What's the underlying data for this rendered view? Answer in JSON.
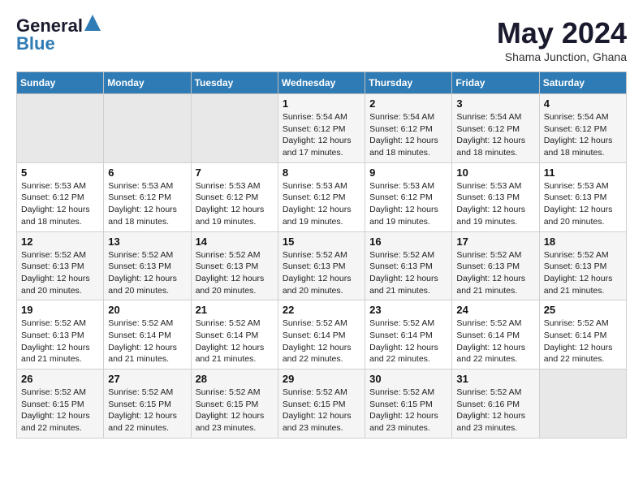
{
  "logo": {
    "line1": "General",
    "line2": "Blue"
  },
  "title": "May 2024",
  "subtitle": "Shama Junction, Ghana",
  "days_of_week": [
    "Sunday",
    "Monday",
    "Tuesday",
    "Wednesday",
    "Thursday",
    "Friday",
    "Saturday"
  ],
  "weeks": [
    [
      {
        "day": "",
        "info": ""
      },
      {
        "day": "",
        "info": ""
      },
      {
        "day": "",
        "info": ""
      },
      {
        "day": "1",
        "info": "Sunrise: 5:54 AM\nSunset: 6:12 PM\nDaylight: 12 hours\nand 17 minutes."
      },
      {
        "day": "2",
        "info": "Sunrise: 5:54 AM\nSunset: 6:12 PM\nDaylight: 12 hours\nand 18 minutes."
      },
      {
        "day": "3",
        "info": "Sunrise: 5:54 AM\nSunset: 6:12 PM\nDaylight: 12 hours\nand 18 minutes."
      },
      {
        "day": "4",
        "info": "Sunrise: 5:54 AM\nSunset: 6:12 PM\nDaylight: 12 hours\nand 18 minutes."
      }
    ],
    [
      {
        "day": "5",
        "info": "Sunrise: 5:53 AM\nSunset: 6:12 PM\nDaylight: 12 hours\nand 18 minutes."
      },
      {
        "day": "6",
        "info": "Sunrise: 5:53 AM\nSunset: 6:12 PM\nDaylight: 12 hours\nand 18 minutes."
      },
      {
        "day": "7",
        "info": "Sunrise: 5:53 AM\nSunset: 6:12 PM\nDaylight: 12 hours\nand 19 minutes."
      },
      {
        "day": "8",
        "info": "Sunrise: 5:53 AM\nSunset: 6:12 PM\nDaylight: 12 hours\nand 19 minutes."
      },
      {
        "day": "9",
        "info": "Sunrise: 5:53 AM\nSunset: 6:12 PM\nDaylight: 12 hours\nand 19 minutes."
      },
      {
        "day": "10",
        "info": "Sunrise: 5:53 AM\nSunset: 6:13 PM\nDaylight: 12 hours\nand 19 minutes."
      },
      {
        "day": "11",
        "info": "Sunrise: 5:53 AM\nSunset: 6:13 PM\nDaylight: 12 hours\nand 20 minutes."
      }
    ],
    [
      {
        "day": "12",
        "info": "Sunrise: 5:52 AM\nSunset: 6:13 PM\nDaylight: 12 hours\nand 20 minutes."
      },
      {
        "day": "13",
        "info": "Sunrise: 5:52 AM\nSunset: 6:13 PM\nDaylight: 12 hours\nand 20 minutes."
      },
      {
        "day": "14",
        "info": "Sunrise: 5:52 AM\nSunset: 6:13 PM\nDaylight: 12 hours\nand 20 minutes."
      },
      {
        "day": "15",
        "info": "Sunrise: 5:52 AM\nSunset: 6:13 PM\nDaylight: 12 hours\nand 20 minutes."
      },
      {
        "day": "16",
        "info": "Sunrise: 5:52 AM\nSunset: 6:13 PM\nDaylight: 12 hours\nand 21 minutes."
      },
      {
        "day": "17",
        "info": "Sunrise: 5:52 AM\nSunset: 6:13 PM\nDaylight: 12 hours\nand 21 minutes."
      },
      {
        "day": "18",
        "info": "Sunrise: 5:52 AM\nSunset: 6:13 PM\nDaylight: 12 hours\nand 21 minutes."
      }
    ],
    [
      {
        "day": "19",
        "info": "Sunrise: 5:52 AM\nSunset: 6:13 PM\nDaylight: 12 hours\nand 21 minutes."
      },
      {
        "day": "20",
        "info": "Sunrise: 5:52 AM\nSunset: 6:14 PM\nDaylight: 12 hours\nand 21 minutes."
      },
      {
        "day": "21",
        "info": "Sunrise: 5:52 AM\nSunset: 6:14 PM\nDaylight: 12 hours\nand 21 minutes."
      },
      {
        "day": "22",
        "info": "Sunrise: 5:52 AM\nSunset: 6:14 PM\nDaylight: 12 hours\nand 22 minutes."
      },
      {
        "day": "23",
        "info": "Sunrise: 5:52 AM\nSunset: 6:14 PM\nDaylight: 12 hours\nand 22 minutes."
      },
      {
        "day": "24",
        "info": "Sunrise: 5:52 AM\nSunset: 6:14 PM\nDaylight: 12 hours\nand 22 minutes."
      },
      {
        "day": "25",
        "info": "Sunrise: 5:52 AM\nSunset: 6:14 PM\nDaylight: 12 hours\nand 22 minutes."
      }
    ],
    [
      {
        "day": "26",
        "info": "Sunrise: 5:52 AM\nSunset: 6:15 PM\nDaylight: 12 hours\nand 22 minutes."
      },
      {
        "day": "27",
        "info": "Sunrise: 5:52 AM\nSunset: 6:15 PM\nDaylight: 12 hours\nand 22 minutes."
      },
      {
        "day": "28",
        "info": "Sunrise: 5:52 AM\nSunset: 6:15 PM\nDaylight: 12 hours\nand 23 minutes."
      },
      {
        "day": "29",
        "info": "Sunrise: 5:52 AM\nSunset: 6:15 PM\nDaylight: 12 hours\nand 23 minutes."
      },
      {
        "day": "30",
        "info": "Sunrise: 5:52 AM\nSunset: 6:15 PM\nDaylight: 12 hours\nand 23 minutes."
      },
      {
        "day": "31",
        "info": "Sunrise: 5:52 AM\nSunset: 6:16 PM\nDaylight: 12 hours\nand 23 minutes."
      },
      {
        "day": "",
        "info": ""
      }
    ]
  ]
}
